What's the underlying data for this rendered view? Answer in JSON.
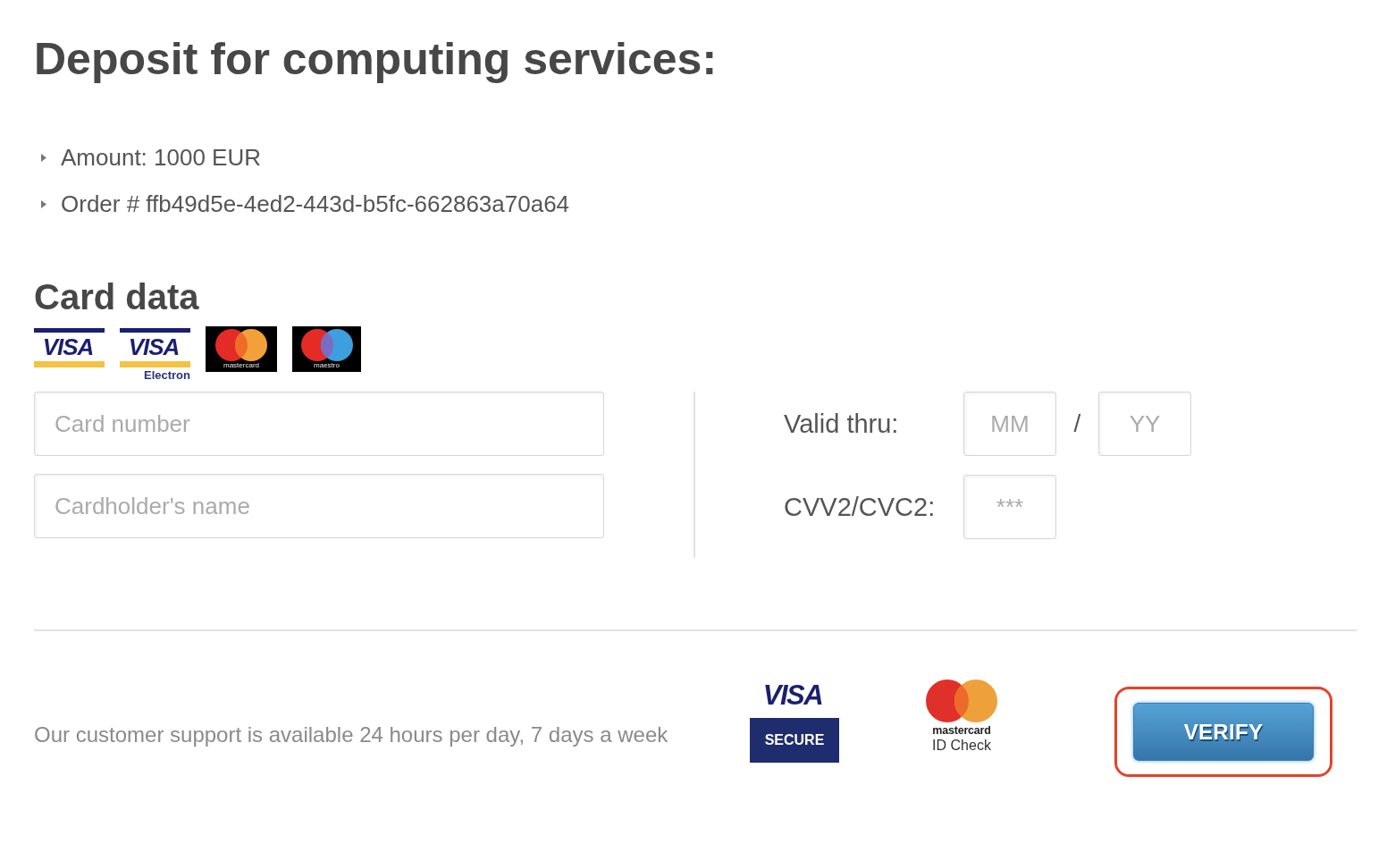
{
  "title": "Deposit for computing services:",
  "details": [
    "Amount: 1000 EUR",
    "Order # ffb49d5e-4ed2-443d-b5fc-662863a70a64"
  ],
  "card_data": {
    "heading": "Card data",
    "logos": [
      {
        "kind": "visa",
        "wordmark": "VISA"
      },
      {
        "kind": "visa_electron",
        "wordmark": "VISA",
        "caption": "Electron"
      },
      {
        "kind": "mastercard",
        "wordmark": "mastercard"
      },
      {
        "kind": "maestro",
        "wordmark": "maestro"
      }
    ],
    "card_number": {
      "placeholder": "Card number"
    },
    "cardholder_name": {
      "placeholder": "Cardholder's name"
    },
    "valid_thru": {
      "label": "Valid thru:",
      "month": {
        "placeholder": "MM"
      },
      "separator": "/",
      "year": {
        "placeholder": "YY"
      }
    },
    "cvv": {
      "label": "CVV2/CVC2:",
      "placeholder": "***"
    }
  },
  "footer": {
    "support_text": "Our customer support is available 24 hours per day, 7 days a week",
    "badges": [
      {
        "kind": "visa_secure",
        "brand": "VISA",
        "label": "SECURE"
      },
      {
        "kind": "mastercard_id_check",
        "brand": "mastercard",
        "label": "ID Check"
      }
    ],
    "verify_button": {
      "label": "VERIFY",
      "highlighted": true
    }
  }
}
